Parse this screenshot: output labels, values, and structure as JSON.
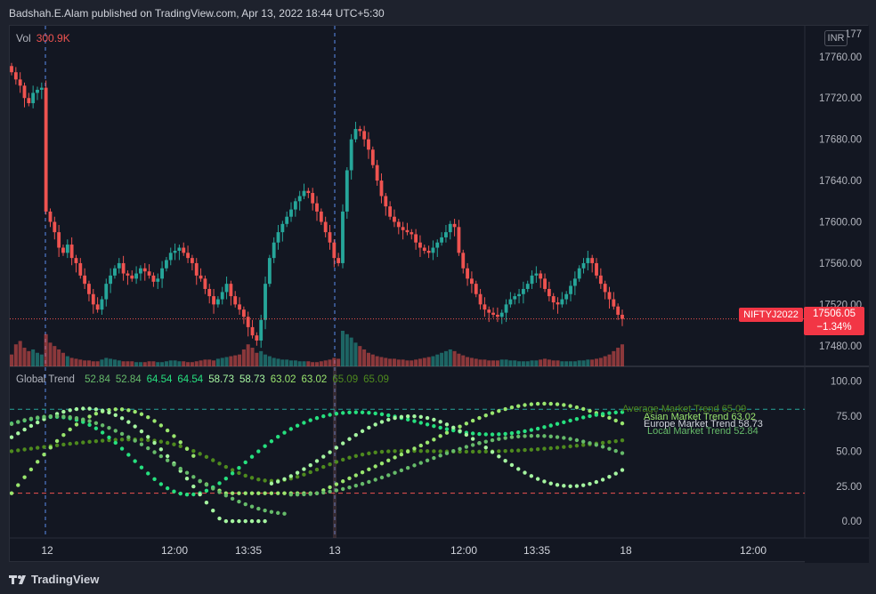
{
  "header": {
    "publisher_line": "Badshah.E.Alam published on TradingView.com, Apr 13, 2022 18:44 UTC+5:30"
  },
  "volume": {
    "label": "Vol",
    "value": "300.9K"
  },
  "currency_badge": "INR",
  "indicator": {
    "name": "Global Trend",
    "values": [
      {
        "text": "52.84",
        "color": "#66bb6a"
      },
      {
        "text": "52.84",
        "color": "#66bb6a"
      },
      {
        "text": "64.54",
        "color": "#26e07f"
      },
      {
        "text": "64.54",
        "color": "#26e07f"
      },
      {
        "text": "58.73",
        "color": "#a5f5a0"
      },
      {
        "text": "58.73",
        "color": "#a5f5a0"
      },
      {
        "text": "63.02",
        "color": "#9ae66e"
      },
      {
        "text": "63.02",
        "color": "#9ae66e"
      },
      {
        "text": "65.09",
        "color": "#4e8a1e"
      },
      {
        "text": "65.09",
        "color": "#4e8a1e"
      }
    ],
    "line_labels": [
      {
        "text": "Average Market Trend 65.09",
        "color": "#4e8a1e"
      },
      {
        "text": "Asian Market Trend 63.02",
        "color": "#9ae66e"
      },
      {
        "text": "Europe Market Trend 58.73",
        "color": "#d1d4dc"
      },
      {
        "text": "Local Market Trend 52.84",
        "color": "#66bb6a"
      }
    ]
  },
  "price_axis": [
    "17760.00",
    "17720.00",
    "17680.00",
    "17640.00",
    "17600.00",
    "17560.00",
    "17520.00",
    "17480.00"
  ],
  "price_axis_top_partial": "177",
  "indicator_axis": [
    "100.00",
    "75.00",
    "50.00",
    "25.00",
    "0.00"
  ],
  "time_axis": [
    "12",
    "12:00",
    "13:35",
    "13",
    "12:00",
    "13:35",
    "18",
    "12:00"
  ],
  "last_price": {
    "ticker": "NIFTYJ2022",
    "price": "17506.05",
    "change": "−1.34%"
  },
  "colors": {
    "up": "#26a69a",
    "down": "#ef5350",
    "background": "#131722",
    "grid": "#2a2e39"
  },
  "footer": {
    "brand": "TradingView"
  },
  "chart_data": {
    "type": "candlestick",
    "price_ylim": [
      17460,
      17790
    ],
    "indicator_ylim": [
      -12,
      110
    ],
    "overbought_level": 80,
    "oversold_level": 20,
    "close_series": [
      17745,
      17738,
      17732,
      17720,
      17715,
      17725,
      17728,
      17730,
      17610,
      17600,
      17590,
      17575,
      17570,
      17578,
      17565,
      17560,
      17548,
      17540,
      17530,
      17520,
      17515,
      17525,
      17540,
      17548,
      17555,
      17560,
      17550,
      17548,
      17545,
      17550,
      17555,
      17552,
      17548,
      17542,
      17545,
      17555,
      17563,
      17570,
      17572,
      17575,
      17570,
      17565,
      17560,
      17548,
      17545,
      17535,
      17528,
      17520,
      17525,
      17532,
      17540,
      17528,
      17520,
      17515,
      17508,
      17498,
      17490,
      17485,
      17505,
      17540,
      17565,
      17580,
      17590,
      17598,
      17605,
      17612,
      17620,
      17625,
      17630,
      17628,
      17618,
      17610,
      17600,
      17590,
      17580,
      17565,
      17560,
      17610,
      17650,
      17680,
      17690,
      17688,
      17680,
      17670,
      17655,
      17640,
      17625,
      17615,
      17605,
      17600,
      17595,
      17592,
      17590,
      17588,
      17580,
      17575,
      17572,
      17570,
      17575,
      17580,
      17585,
      17590,
      17598,
      17595,
      17570,
      17555,
      17545,
      17540,
      17530,
      17520,
      17515,
      17512,
      17510,
      17508,
      17512,
      17520,
      17525,
      17528,
      17530,
      17535,
      17540,
      17548,
      17550,
      17545,
      17535,
      17528,
      17522,
      17520,
      17525,
      17530,
      17538,
      17545,
      17555,
      17560,
      17565,
      17560,
      17548,
      17540,
      17532,
      17525,
      17518,
      17510,
      17506
    ],
    "volume_series": [
      14,
      26,
      30,
      22,
      18,
      20,
      16,
      14,
      38,
      28,
      24,
      20,
      16,
      12,
      10,
      9,
      8,
      7,
      7,
      6,
      6,
      8,
      10,
      9,
      8,
      7,
      6,
      6,
      6,
      5,
      5,
      5,
      6,
      6,
      5,
      5,
      6,
      7,
      7,
      6,
      6,
      5,
      5,
      6,
      7,
      8,
      8,
      7,
      9,
      10,
      11,
      12,
      13,
      14,
      20,
      26,
      22,
      16,
      18,
      14,
      12,
      10,
      9,
      8,
      8,
      7,
      7,
      6,
      6,
      6,
      5,
      5,
      6,
      7,
      8,
      10,
      9,
      42,
      38,
      34,
      28,
      24,
      20,
      16,
      14,
      12,
      11,
      10,
      9,
      9,
      8,
      8,
      7,
      7,
      8,
      9,
      10,
      11,
      12,
      14,
      16,
      18,
      20,
      18,
      15,
      13,
      11,
      10,
      9,
      8,
      8,
      7,
      7,
      7,
      8,
      8,
      7,
      7,
      6,
      6,
      6,
      7,
      7,
      8,
      9,
      8,
      7,
      7,
      6,
      6,
      6,
      6,
      7,
      7,
      8,
      8,
      9,
      10,
      12,
      14,
      18,
      22,
      26
    ]
  }
}
